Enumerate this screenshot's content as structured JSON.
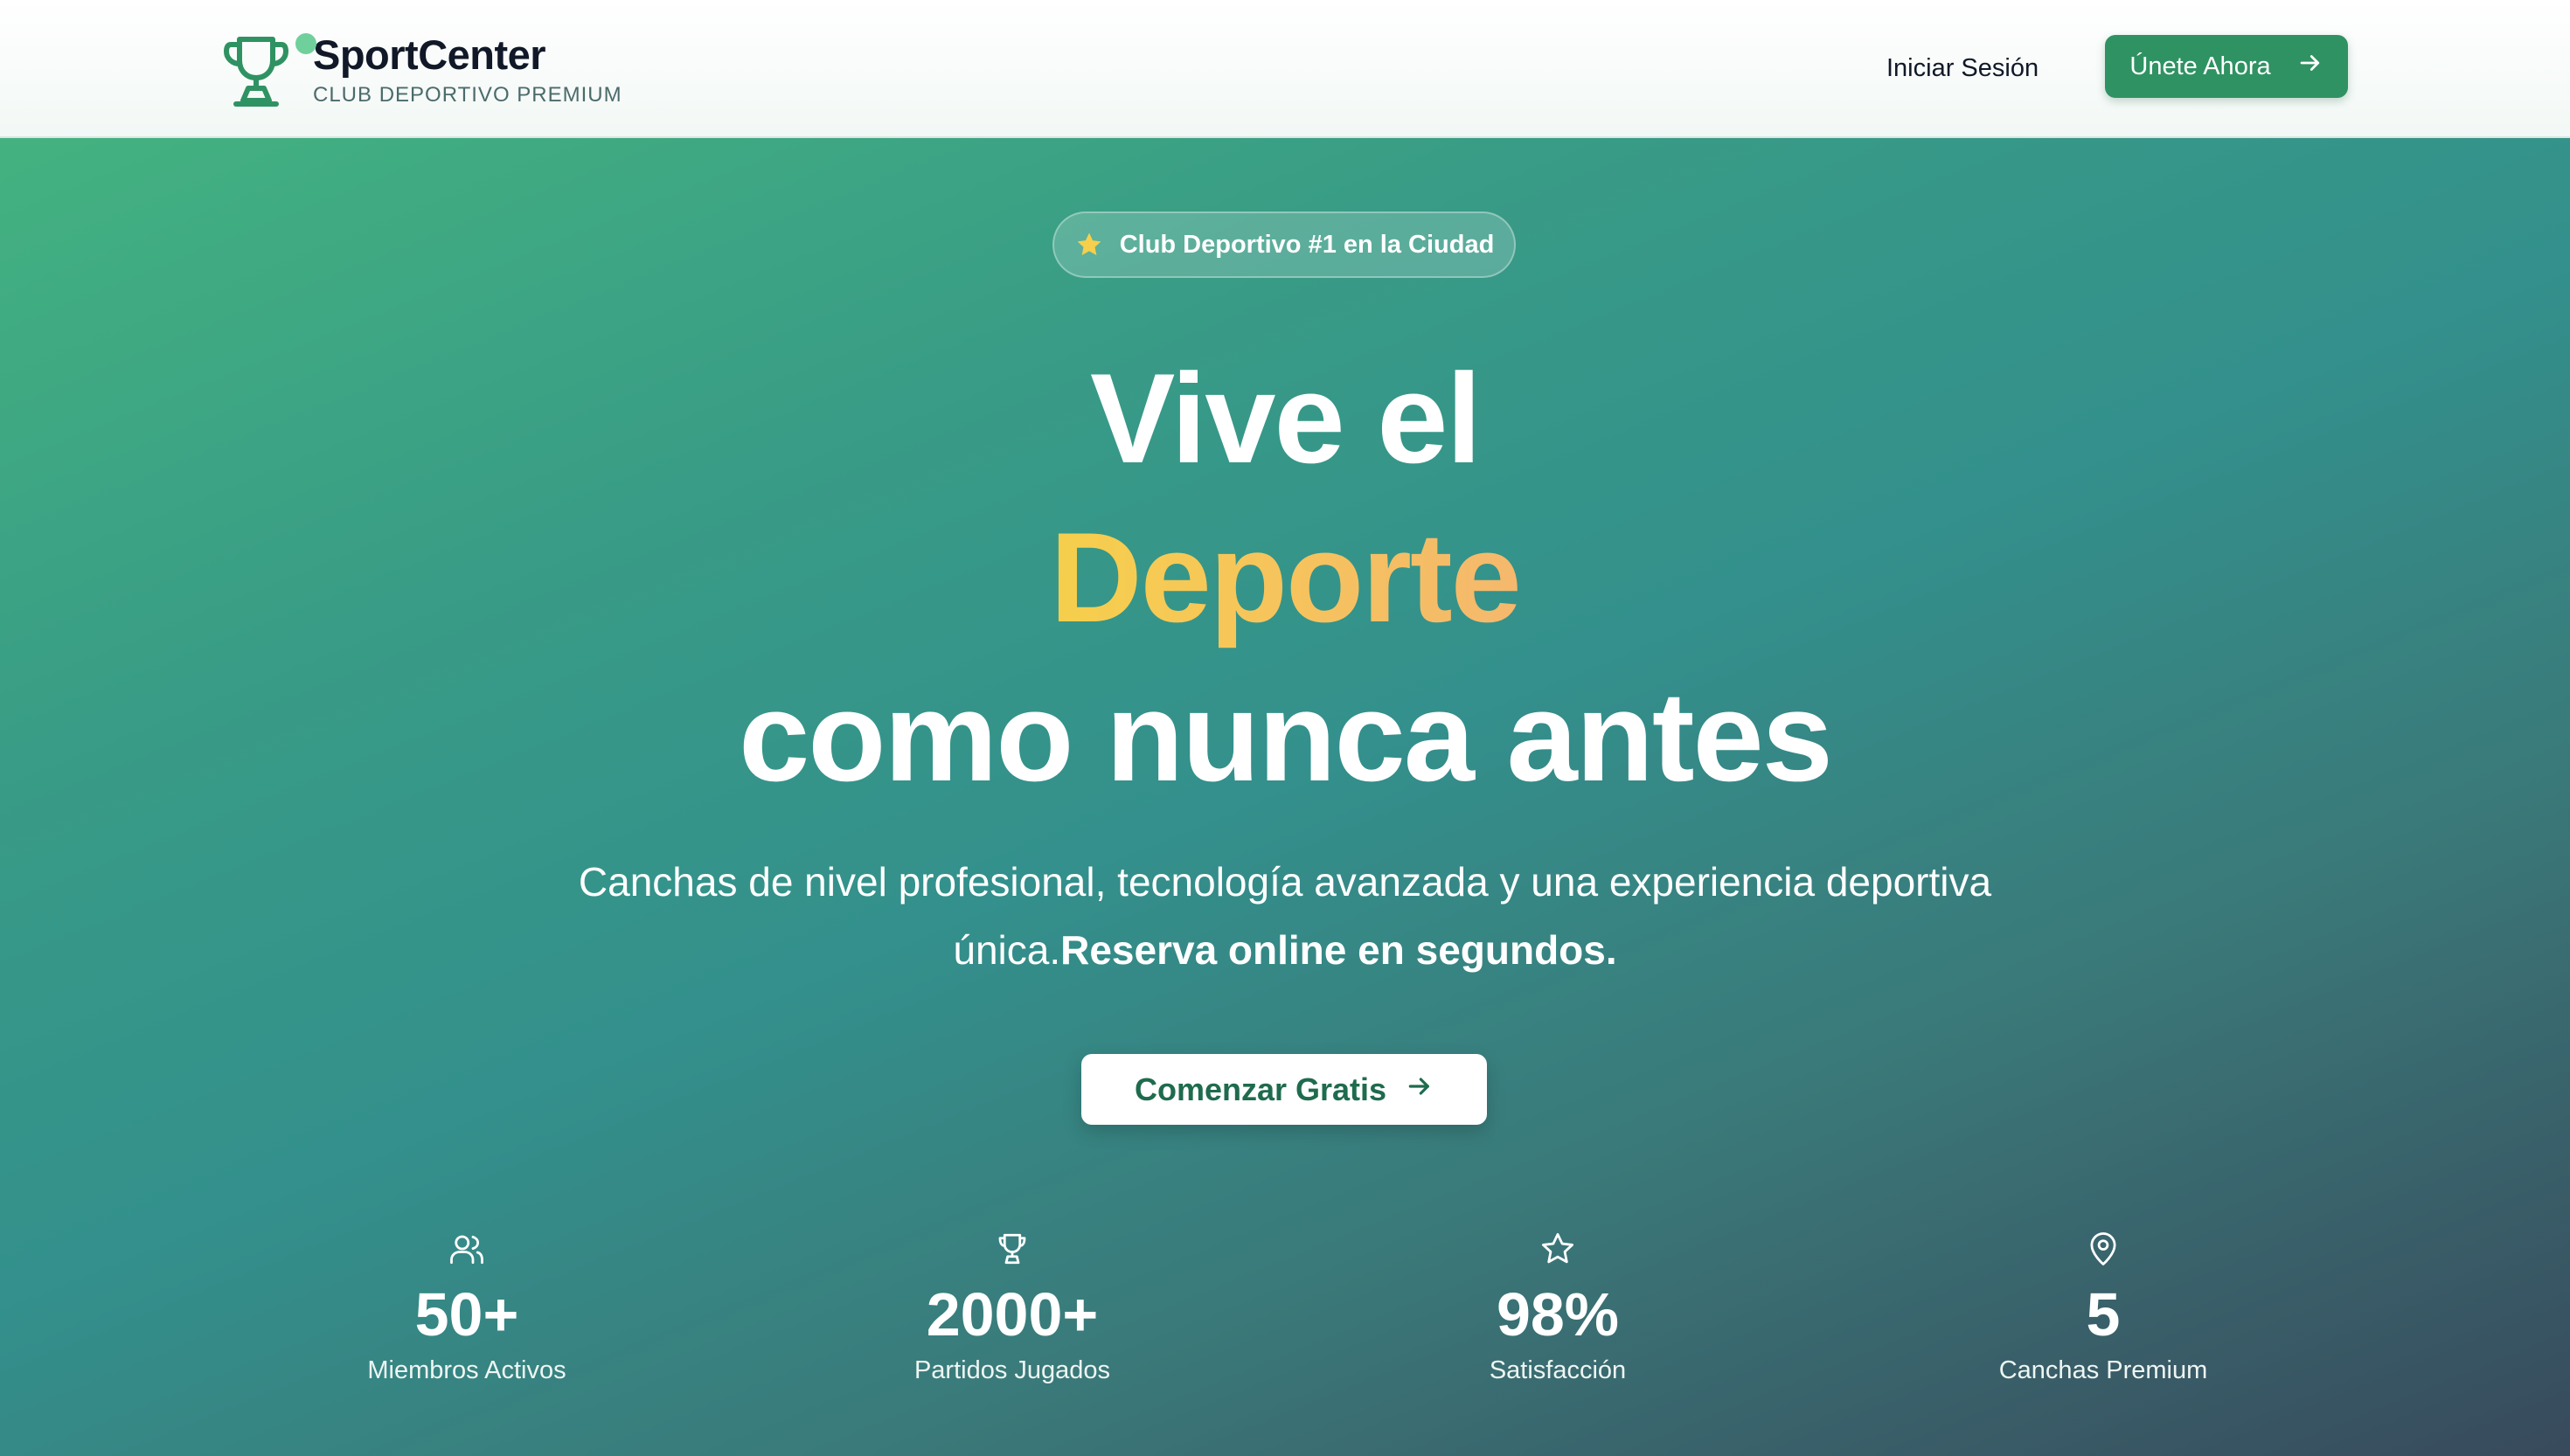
{
  "header": {
    "brand_name": "SportCenter",
    "brand_tagline": "CLUB DEPORTIVO PREMIUM",
    "logo_icon": "trophy-icon",
    "login_label": "Iniciar Sesión",
    "join_label": "Únete Ahora",
    "join_icon": "arrow-right-icon"
  },
  "hero": {
    "badge_icon": "star-icon",
    "badge_text": "Club Deportivo #1 en la Ciudad",
    "title_line1": "Vive el",
    "title_highlight": "Deporte",
    "title_line3": "como nunca antes",
    "subtitle_text": "Canchas de nivel profesional, tecnología avanzada y una experiencia deportiva única.",
    "subtitle_strong": "Reserva online en segundos.",
    "cta_label": "Comenzar Gratis",
    "cta_icon": "arrow-right-icon"
  },
  "stats": [
    {
      "icon": "users-icon",
      "value": "50+",
      "label": "Miembros Activos"
    },
    {
      "icon": "trophy-icon",
      "value": "2000+",
      "label": "Partidos Jugados"
    },
    {
      "icon": "star-icon",
      "value": "98%",
      "label": "Satisfacción"
    },
    {
      "icon": "map-pin-icon",
      "value": "5",
      "label": "Canchas Premium"
    }
  ],
  "colors": {
    "brand_green": "#2f9262",
    "highlight_start": "#f6cf4c",
    "highlight_end": "#f5b86d",
    "cta_text": "#1f6b4e"
  }
}
